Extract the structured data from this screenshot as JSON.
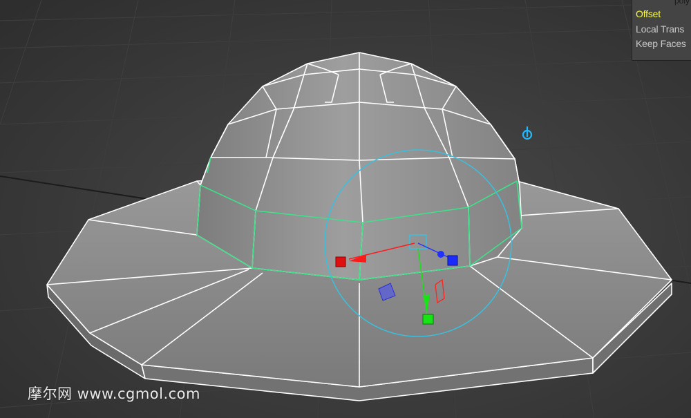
{
  "channel_box": {
    "title": "poly",
    "items": [
      {
        "label": "Offset",
        "active": true
      },
      {
        "label": "Local Trans",
        "active": false
      },
      {
        "label": "Keep Faces",
        "active": false
      }
    ]
  },
  "watermark": "摩尔网 www.cgmol.com",
  "colors": {
    "background": "#2f2f2f",
    "grid_line": "#3a3a3a",
    "mesh_fill": "#8c8c8c",
    "wireframe": "#ffffff",
    "selected_edges": "#3ee08a",
    "manipulator_ring": "#38c0de",
    "x_axis": "#ff1a1a",
    "y_axis": "#17e317",
    "z_axis": "#1a2bff",
    "highlight_text": "#ffff3a"
  },
  "icons": {
    "pivot": "pivot-icon"
  }
}
